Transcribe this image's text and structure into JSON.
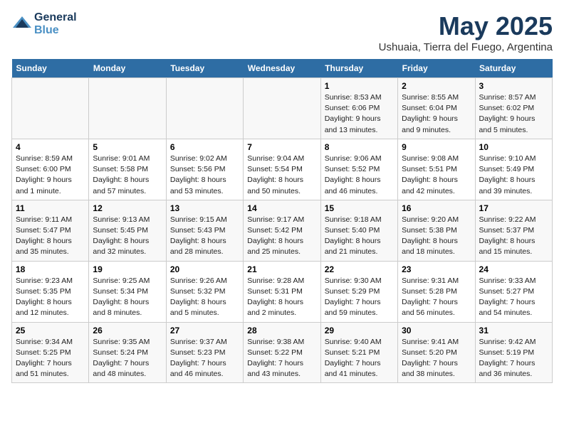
{
  "logo": {
    "line1": "General",
    "line2": "Blue"
  },
  "title": "May 2025",
  "subtitle": "Ushuaia, Tierra del Fuego, Argentina",
  "days_of_week": [
    "Sunday",
    "Monday",
    "Tuesday",
    "Wednesday",
    "Thursday",
    "Friday",
    "Saturday"
  ],
  "weeks": [
    [
      {
        "day": "",
        "detail": ""
      },
      {
        "day": "",
        "detail": ""
      },
      {
        "day": "",
        "detail": ""
      },
      {
        "day": "",
        "detail": ""
      },
      {
        "day": "1",
        "detail": "Sunrise: 8:53 AM\nSunset: 6:06 PM\nDaylight: 9 hours and 13 minutes."
      },
      {
        "day": "2",
        "detail": "Sunrise: 8:55 AM\nSunset: 6:04 PM\nDaylight: 9 hours and 9 minutes."
      },
      {
        "day": "3",
        "detail": "Sunrise: 8:57 AM\nSunset: 6:02 PM\nDaylight: 9 hours and 5 minutes."
      }
    ],
    [
      {
        "day": "4",
        "detail": "Sunrise: 8:59 AM\nSunset: 6:00 PM\nDaylight: 9 hours and 1 minute."
      },
      {
        "day": "5",
        "detail": "Sunrise: 9:01 AM\nSunset: 5:58 PM\nDaylight: 8 hours and 57 minutes."
      },
      {
        "day": "6",
        "detail": "Sunrise: 9:02 AM\nSunset: 5:56 PM\nDaylight: 8 hours and 53 minutes."
      },
      {
        "day": "7",
        "detail": "Sunrise: 9:04 AM\nSunset: 5:54 PM\nDaylight: 8 hours and 50 minutes."
      },
      {
        "day": "8",
        "detail": "Sunrise: 9:06 AM\nSunset: 5:52 PM\nDaylight: 8 hours and 46 minutes."
      },
      {
        "day": "9",
        "detail": "Sunrise: 9:08 AM\nSunset: 5:51 PM\nDaylight: 8 hours and 42 minutes."
      },
      {
        "day": "10",
        "detail": "Sunrise: 9:10 AM\nSunset: 5:49 PM\nDaylight: 8 hours and 39 minutes."
      }
    ],
    [
      {
        "day": "11",
        "detail": "Sunrise: 9:11 AM\nSunset: 5:47 PM\nDaylight: 8 hours and 35 minutes."
      },
      {
        "day": "12",
        "detail": "Sunrise: 9:13 AM\nSunset: 5:45 PM\nDaylight: 8 hours and 32 minutes."
      },
      {
        "day": "13",
        "detail": "Sunrise: 9:15 AM\nSunset: 5:43 PM\nDaylight: 8 hours and 28 minutes."
      },
      {
        "day": "14",
        "detail": "Sunrise: 9:17 AM\nSunset: 5:42 PM\nDaylight: 8 hours and 25 minutes."
      },
      {
        "day": "15",
        "detail": "Sunrise: 9:18 AM\nSunset: 5:40 PM\nDaylight: 8 hours and 21 minutes."
      },
      {
        "day": "16",
        "detail": "Sunrise: 9:20 AM\nSunset: 5:38 PM\nDaylight: 8 hours and 18 minutes."
      },
      {
        "day": "17",
        "detail": "Sunrise: 9:22 AM\nSunset: 5:37 PM\nDaylight: 8 hours and 15 minutes."
      }
    ],
    [
      {
        "day": "18",
        "detail": "Sunrise: 9:23 AM\nSunset: 5:35 PM\nDaylight: 8 hours and 12 minutes."
      },
      {
        "day": "19",
        "detail": "Sunrise: 9:25 AM\nSunset: 5:34 PM\nDaylight: 8 hours and 8 minutes."
      },
      {
        "day": "20",
        "detail": "Sunrise: 9:26 AM\nSunset: 5:32 PM\nDaylight: 8 hours and 5 minutes."
      },
      {
        "day": "21",
        "detail": "Sunrise: 9:28 AM\nSunset: 5:31 PM\nDaylight: 8 hours and 2 minutes."
      },
      {
        "day": "22",
        "detail": "Sunrise: 9:30 AM\nSunset: 5:29 PM\nDaylight: 7 hours and 59 minutes."
      },
      {
        "day": "23",
        "detail": "Sunrise: 9:31 AM\nSunset: 5:28 PM\nDaylight: 7 hours and 56 minutes."
      },
      {
        "day": "24",
        "detail": "Sunrise: 9:33 AM\nSunset: 5:27 PM\nDaylight: 7 hours and 54 minutes."
      }
    ],
    [
      {
        "day": "25",
        "detail": "Sunrise: 9:34 AM\nSunset: 5:25 PM\nDaylight: 7 hours and 51 minutes."
      },
      {
        "day": "26",
        "detail": "Sunrise: 9:35 AM\nSunset: 5:24 PM\nDaylight: 7 hours and 48 minutes."
      },
      {
        "day": "27",
        "detail": "Sunrise: 9:37 AM\nSunset: 5:23 PM\nDaylight: 7 hours and 46 minutes."
      },
      {
        "day": "28",
        "detail": "Sunrise: 9:38 AM\nSunset: 5:22 PM\nDaylight: 7 hours and 43 minutes."
      },
      {
        "day": "29",
        "detail": "Sunrise: 9:40 AM\nSunset: 5:21 PM\nDaylight: 7 hours and 41 minutes."
      },
      {
        "day": "30",
        "detail": "Sunrise: 9:41 AM\nSunset: 5:20 PM\nDaylight: 7 hours and 38 minutes."
      },
      {
        "day": "31",
        "detail": "Sunrise: 9:42 AM\nSunset: 5:19 PM\nDaylight: 7 hours and 36 minutes."
      }
    ]
  ]
}
